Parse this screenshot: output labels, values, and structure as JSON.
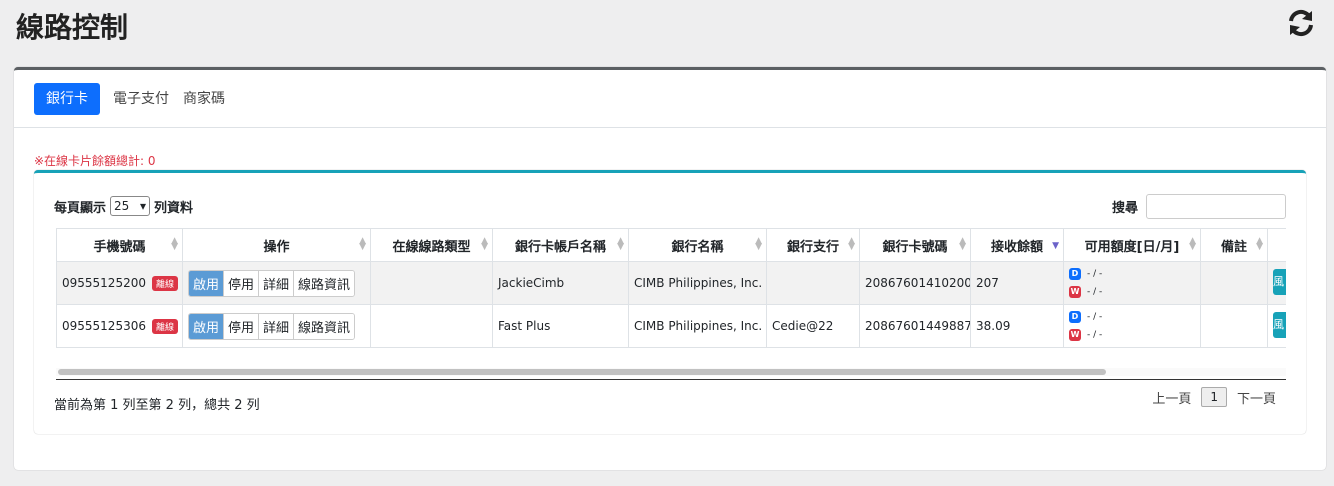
{
  "page": {
    "title": "線路控制"
  },
  "tabs": [
    "銀行卡",
    "電子支付",
    "商家碼"
  ],
  "total_note": "※在線卡片餘額總計: 0",
  "table_controls": {
    "length_prefix": "每頁顯示",
    "length_value": "25",
    "length_suffix": "列資料",
    "search_label": "搜尋"
  },
  "columns": [
    "手機號碼",
    "操作",
    "在線線路類型",
    "銀行卡帳戶名稱",
    "銀行名稱",
    "銀行支行",
    "銀行卡號碼",
    "接收餘額",
    "可用額度[日/月]",
    "備註"
  ],
  "action_labels": [
    "啟用",
    "停用",
    "詳細",
    "線路資訊"
  ],
  "offline_badge": "離線",
  "limit_chips": {
    "daily": "D",
    "weekly": "W",
    "value": "- / -"
  },
  "rows": [
    {
      "phone": "09555125200",
      "line_type": "",
      "account_name": "JackieCimb",
      "bank_name": "CIMB Philippines, Inc.",
      "branch": "",
      "card_no": "20867601410200",
      "balance": "207",
      "note": "",
      "edge_btn": "風"
    },
    {
      "phone": "09555125306",
      "line_type": "",
      "account_name": "Fast Plus",
      "bank_name": "CIMB Philippines, Inc.",
      "branch": "Cedie@22",
      "card_no": "20867601449887",
      "balance": "38.09",
      "note": "",
      "edge_btn": "風"
    }
  ],
  "footer": {
    "info": "當前為第 1 列至第 2 列，總共 2 列",
    "prev": "上一頁",
    "current_page": "1",
    "next": "下一頁"
  }
}
